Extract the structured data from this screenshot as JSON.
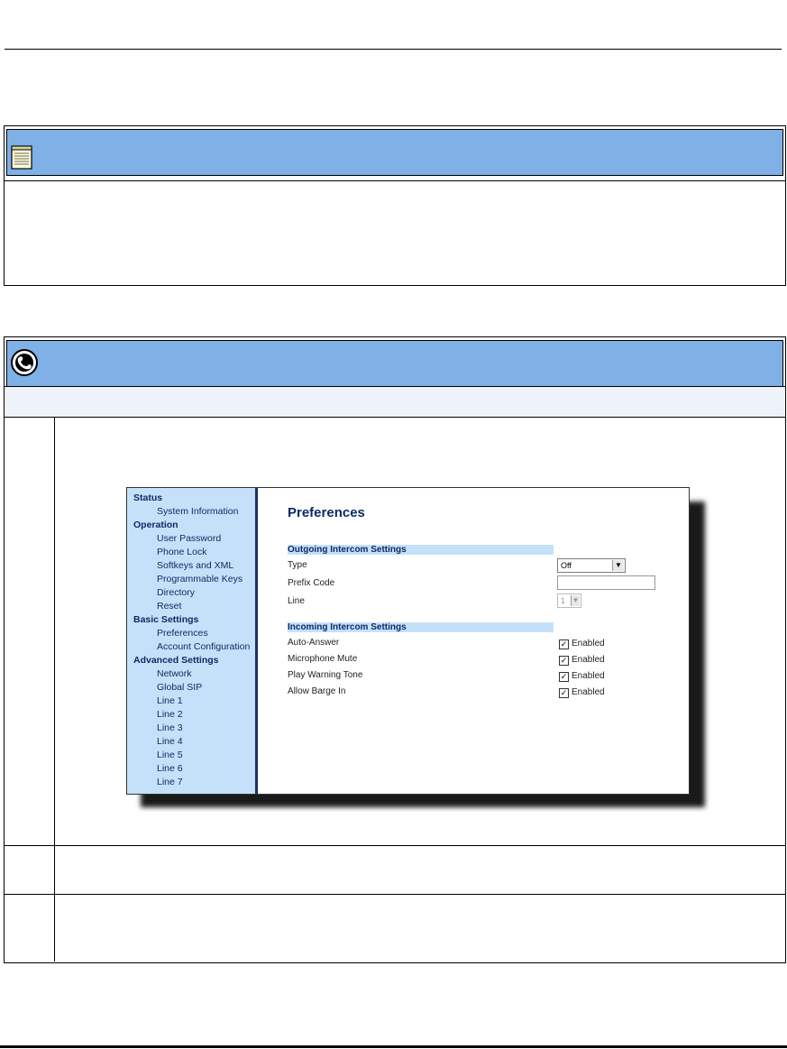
{
  "prefs": {
    "title": "Preferences",
    "nav": {
      "status": "Status",
      "system_information": "System Information",
      "operation": "Operation",
      "user_password": "User Password",
      "phone_lock": "Phone Lock",
      "softkeys_xml": "Softkeys and XML",
      "programmable_keys": "Programmable Keys",
      "directory": "Directory",
      "reset": "Reset",
      "basic_settings": "Basic Settings",
      "preferences": "Preferences",
      "account_configuration": "Account Configuration",
      "advanced_settings": "Advanced Settings",
      "network": "Network",
      "global_sip": "Global SIP",
      "line1": "Line 1",
      "line2": "Line 2",
      "line3": "Line 3",
      "line4": "Line 4",
      "line5": "Line 5",
      "line6": "Line 6",
      "line7": "Line 7"
    },
    "outgoing": {
      "header": "Outgoing Intercom Settings",
      "type_label": "Type",
      "type_value": "Off",
      "prefix_label": "Prefix Code",
      "prefix_value": "",
      "line_label": "Line",
      "line_value": "1"
    },
    "incoming": {
      "header": "Incoming Intercom Settings",
      "auto_answer_label": "Auto-Answer",
      "mic_mute_label": "Microphone Mute",
      "warning_tone_label": "Play Warning Tone",
      "barge_in_label": "Allow Barge In",
      "enabled_label": "Enabled"
    }
  }
}
